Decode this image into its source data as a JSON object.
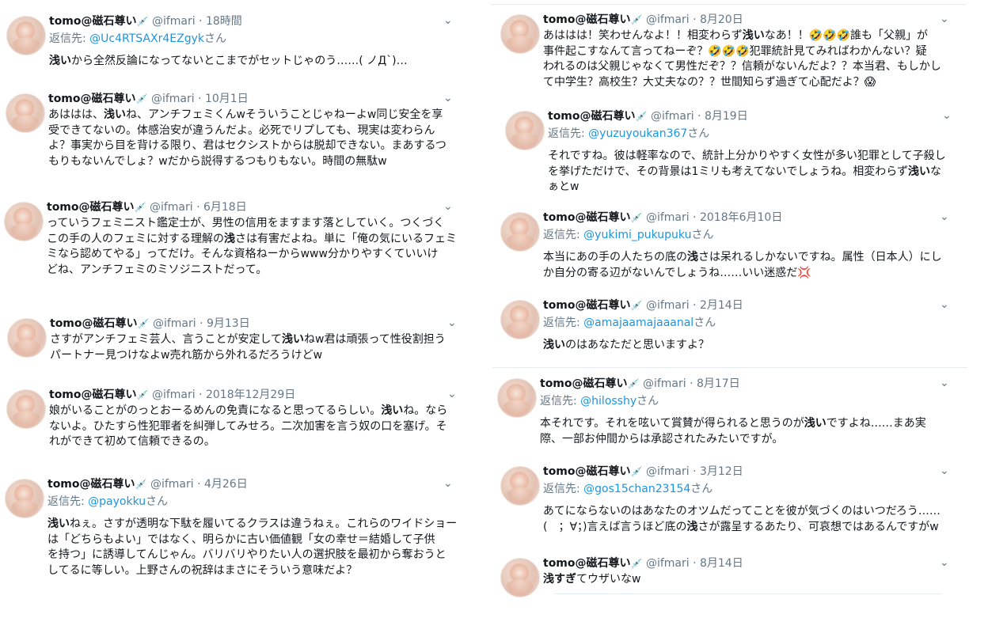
{
  "user": {
    "name": "tomo@磁石尊い",
    "badge": "💉",
    "handle": "@ifmari",
    "dot": "·"
  },
  "left_col": [
    {
      "time": "18時間",
      "reply_prefix": "返信先: ",
      "reply_to": "@Uc4RTSAXr4EZgyk",
      "reply_suffix": "さん",
      "lines": [
        [
          "",
          "浅い",
          "から全然反論になってないとこまでがセットじゃのう……( ノД`)…"
        ]
      ]
    },
    {
      "time": "10月1日",
      "lines": [
        [
          "あははは、",
          "浅い",
          "ね、アンチフェミくんwそういうことじゃねーよw同じ安全を享"
        ],
        [
          "受できてないの。体感治安が違うんだよ。必死でリプしても、現実は変わらん",
          "",
          ""
        ],
        [
          "よ？事実から目を背ける限り、君はセクシストからは脱却できない。まあするつ",
          "",
          ""
        ],
        [
          "もりもないんでしょ？wだから説得するつもりもない。時間の無駄w",
          "",
          ""
        ]
      ]
    },
    {
      "time": "6月18日",
      "lines": [
        [
          "っていうフェミニスト鑑定士が、男性の信用をますます落としていく。つくづく",
          "",
          ""
        ],
        [
          "この手の人のフェミに対する理解の",
          "浅",
          "さは有害だよね。単に「俺の気にいるフェミ"
        ],
        [
          "ミなら認めてやる」ってだけ。そんな資格ねーからwww分かりやすくていいけ",
          "",
          ""
        ],
        [
          "どね、アンチフェミのミソジニストだって。",
          "",
          ""
        ]
      ]
    },
    {
      "time": "9月13日",
      "lines": [
        [
          "さすがアンチフェミ芸人、言うことが安定して",
          "浅い",
          "ねw君は頑張って性役割担う"
        ],
        [
          "パートナー見つけなよw売れ筋から外れるだろうけどw",
          "",
          ""
        ]
      ]
    },
    {
      "time": "2018年12月29日",
      "lines": [
        [
          "娘がいることがのっとおーるめんの免責になると思ってるらしい。",
          "浅い",
          "ね。なら"
        ],
        [
          "ないよ。ひたすら性犯罪者を糾弾してみせろ。二次加害を言う奴の口を塞げ。そ",
          "",
          ""
        ],
        [
          "れができて初めて信頼できるの。",
          "",
          ""
        ]
      ]
    },
    {
      "time": "4月26日",
      "reply_prefix": "返信先: ",
      "reply_to": "@payokku",
      "reply_suffix": "さん",
      "lines": [
        [
          "",
          "浅い",
          "ねぇ。さすが透明な下駄を履いてるクラスは違うねぇ。これらのワイドショー"
        ],
        [
          "は「どちらもよい」ではなく、明らかに古い価値観「女の幸せ＝結婚して子供",
          "",
          ""
        ],
        [
          "を持つ」に誘導してんじゃん。バリバリやりたい人の選択肢を最初から奪おうと",
          "",
          ""
        ],
        [
          "してるに等しい。上野さんの祝辞はまさにそういう意味だよ？",
          "",
          ""
        ]
      ]
    }
  ],
  "right_col": [
    {
      "time": "8月20日",
      "lines": [
        [
          "あははは！笑わせんなよ！！相変わらず",
          "浅い",
          "なあ！！🤣🤣🤣誰も「父親」が"
        ],
        [
          "事件起こすなんて言ってねーぞ？🤣🤣🤣犯罪統計見てみればわかんない？疑",
          "",
          ""
        ],
        [
          "われるのは父親じゃなくて男性だぞ？？信頼がないんだよ？？本当君、もしかし",
          "",
          ""
        ],
        [
          "て中学生？高校生？大丈夫なの？？世間知らず過ぎて心配だよ？😱",
          "",
          ""
        ]
      ]
    },
    {
      "time": "8月19日",
      "reply_prefix": "返信先: ",
      "reply_to": "@yuzuyoukan367",
      "reply_suffix": "さん",
      "lines": [
        [
          "それですね。彼は軽率なので、統計上分かりやすく女性が多い犯罪として子殺し",
          "",
          ""
        ],
        [
          "を挙げただけで、その背景は1ミリも考えてないでしょうね。相変わらず",
          "浅い",
          "な"
        ],
        [
          "ぁとw",
          "",
          ""
        ]
      ]
    },
    {
      "time": "2018年6月10日",
      "reply_prefix": "返信先: ",
      "reply_to": "@yukimi_pukupuku",
      "reply_suffix": "さん",
      "lines": [
        [
          "本当にあの手の人たちの底の",
          "浅",
          "さは呆れるしかないですね。属性（日本人）にし"
        ],
        [
          "か自分の寄る辺がないんでしょうね……いい迷惑だ💢",
          "",
          ""
        ]
      ]
    },
    {
      "time": "2月14日",
      "reply_prefix": "返信先: ",
      "reply_to": "@amajaamajaaanal",
      "reply_suffix": "さん",
      "lines": [
        [
          "",
          "浅い",
          "のはあなただと思いますよ？"
        ]
      ]
    },
    {
      "time": "8月17日",
      "reply_prefix": "返信先: ",
      "reply_to": "@hilosshy",
      "reply_suffix": "さん",
      "lines": [
        [
          "本それです。それを呟いて賞賛が得られると思うのが",
          "浅い",
          "ですよね……まあ実"
        ],
        [
          "際、一部お仲間からは承認されたみたいですが。",
          "",
          ""
        ]
      ]
    },
    {
      "time": "3月12日",
      "reply_prefix": "返信先: ",
      "reply_to": "@gos15chan23154",
      "reply_suffix": "さん",
      "lines": [
        [
          "あてにならないのはあなたのオツムだってことを彼が気づくのはいつだろう……",
          "",
          ""
        ],
        [
          "(　；∀；)言えば言うほど底の",
          "浅",
          "さが露呈するあたり、可哀想ではあるんですがw"
        ]
      ]
    },
    {
      "time": "8月14日",
      "lines": [
        [
          "",
          "浅すぎ",
          "てウザいなw"
        ]
      ]
    }
  ],
  "icons": {
    "chevron": "chevron-down-icon",
    "badge": "syringe-icon"
  },
  "colors": {
    "link": "#1b95e0",
    "muted": "#657786",
    "text": "#14171a",
    "divider": "#e6ecf0"
  }
}
